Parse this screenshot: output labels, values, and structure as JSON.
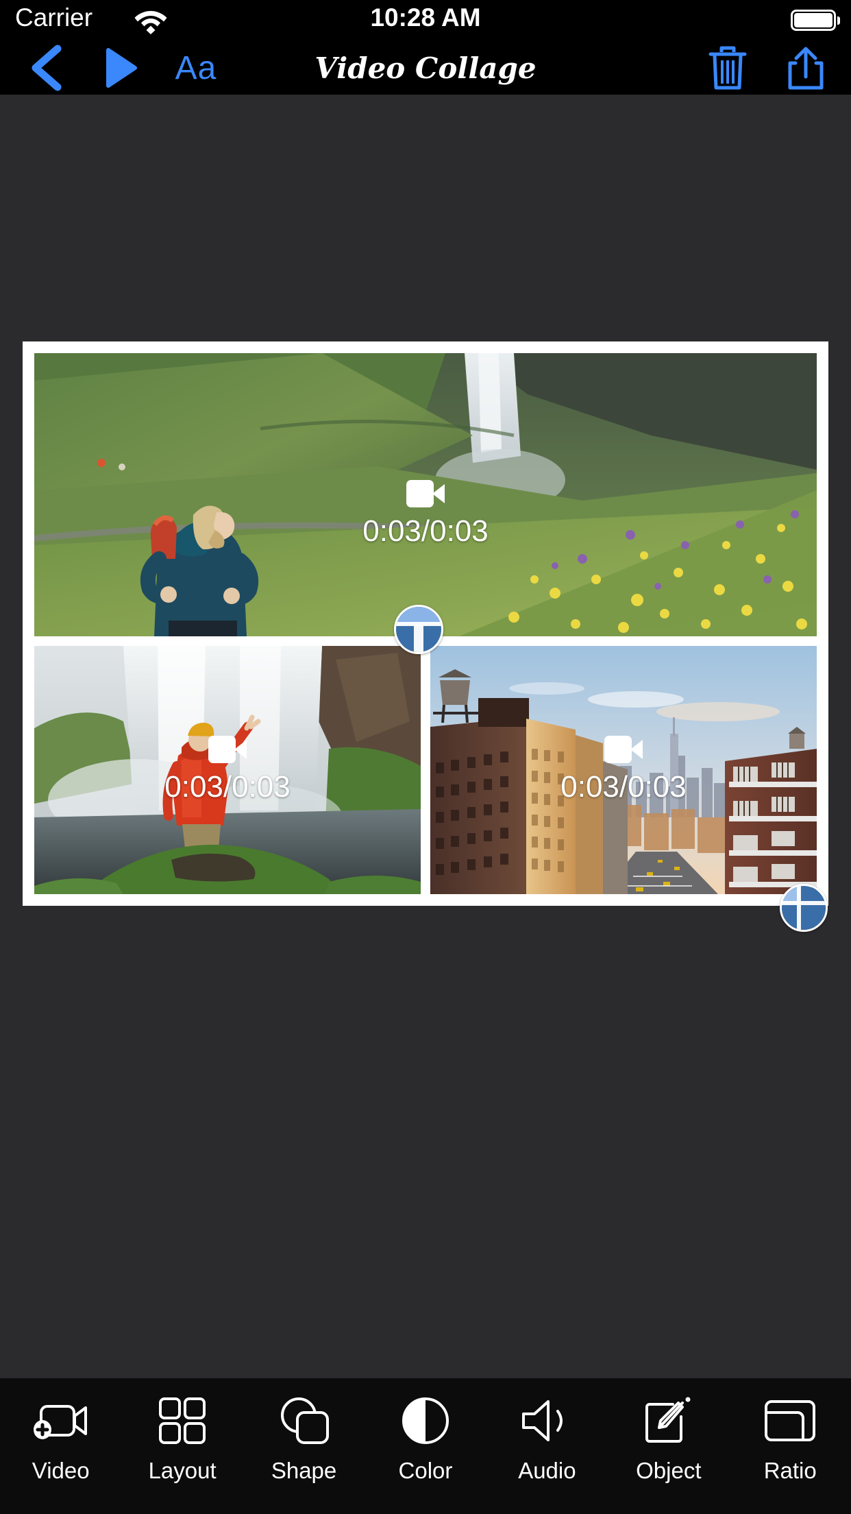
{
  "status_bar": {
    "carrier": "Carrier",
    "wifi_icon": "wifi-icon",
    "time": "10:28 AM",
    "battery_icon": "battery-full-icon"
  },
  "nav_bar": {
    "title": "Video Collage",
    "back_icon": "chevron-left-icon",
    "play_icon": "play-triangle-icon",
    "text_label": "Aa",
    "trash_icon": "trash-icon",
    "share_icon": "share-up-arrow-icon",
    "accent_color": "#3a88fb"
  },
  "canvas": {
    "background_color": "#2b2b2e",
    "frame_color": "#ffffff",
    "cells": [
      {
        "id": "cell-top",
        "scene": "hiker-with-backpack-green-hillside-waterfall",
        "video_icon": "video-camera-icon",
        "timer": "0:03/0:03"
      },
      {
        "id": "cell-bottom-left",
        "scene": "person-red-jacket-arm-raised-in-front-of-waterfall",
        "video_icon": "video-camera-icon",
        "timer": "0:03/0:03"
      },
      {
        "id": "cell-bottom-right",
        "scene": "new-york-city-skyline-rooftops-at-sunset",
        "video_icon": "video-camera-icon",
        "timer": "0:03/0:03"
      }
    ],
    "handles": [
      {
        "id": "divider-handle",
        "icon": "resize-divider-handle"
      },
      {
        "id": "corner-handle",
        "icon": "resize-corner-handle"
      }
    ],
    "handle_color": "#3a6ea8"
  },
  "toolbar": {
    "background_color": "#0c0c0d",
    "items": [
      {
        "label": "Video",
        "icon": "video-add-icon"
      },
      {
        "label": "Layout",
        "icon": "grid-layout-icon"
      },
      {
        "label": "Shape",
        "icon": "shape-overlap-icon"
      },
      {
        "label": "Color",
        "icon": "contrast-half-circle-icon"
      },
      {
        "label": "Audio",
        "icon": "speaker-volume-icon"
      },
      {
        "label": "Object",
        "icon": "pencil-square-icon"
      },
      {
        "label": "Ratio",
        "icon": "aspect-ratio-icon"
      }
    ]
  }
}
